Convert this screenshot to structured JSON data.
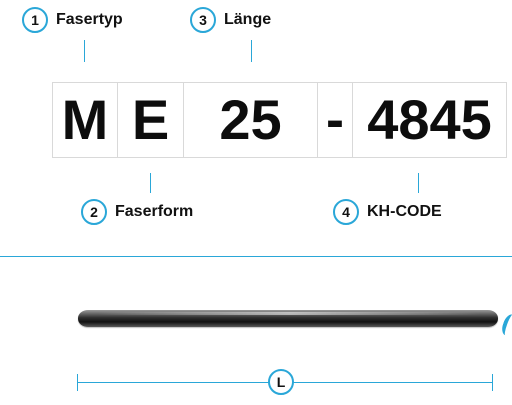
{
  "callouts": [
    {
      "num": "1",
      "label": "Fasertyp"
    },
    {
      "num": "2",
      "label": "Faserform"
    },
    {
      "num": "3",
      "label": "Länge"
    },
    {
      "num": "4",
      "label": "KH-CODE"
    }
  ],
  "code": {
    "type": "M",
    "form": "E",
    "length": "25",
    "dash": "-",
    "kh": "4845"
  },
  "dimension": {
    "label": "L"
  },
  "colors": {
    "accent": "#2aa7d8",
    "box_border": "#d9d9d9",
    "text": "#111111"
  }
}
